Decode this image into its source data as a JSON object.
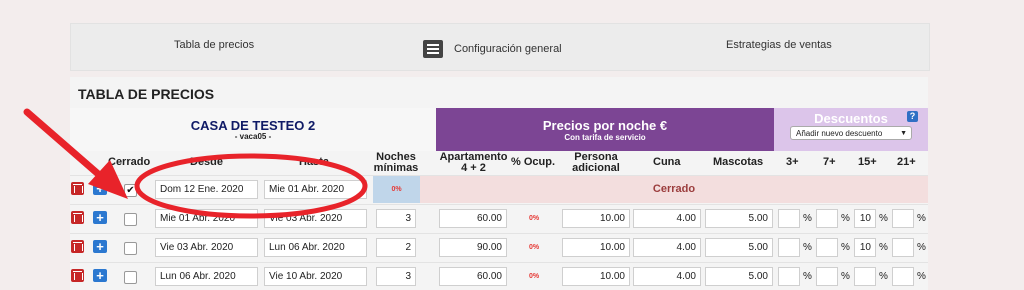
{
  "tabs": {
    "precios": "Tabla de precios",
    "config": "Configuración general",
    "estrategias": "Estrategias de ventas"
  },
  "page_title": "TABLA DE PRECIOS",
  "house": {
    "name": "CASA DE TESTEO 2",
    "code": "- vaca05 -"
  },
  "prices_header": {
    "title": "Precios por noche €",
    "subtitle": "Con tarifa de servicio"
  },
  "discounts": {
    "title": "Descuentos",
    "help": "?",
    "select_value": "Añadir nuevo descuento"
  },
  "columns": {
    "cerrado": "Cerrado",
    "desde": "Desde",
    "hasta": "Hasta",
    "noches_1": "Noches",
    "noches_2": "mínimas",
    "apto_1": "Apartamento",
    "apto_2": "4 + 2",
    "ocup": "% Ocup.",
    "persona_1": "Persona",
    "persona_2": "adicional",
    "cuna": "Cuna",
    "mascotas": "Mascotas",
    "d3": "3+",
    "d7": "7+",
    "d15": "15+",
    "d21": "21+"
  },
  "closed_row": {
    "desde": "Dom 12 Ene. 2020",
    "hasta": "Mie 01 Abr. 2020",
    "pct": "0%",
    "label": "Cerrado"
  },
  "rows": [
    {
      "desde": "Mie 01 Abr. 2020",
      "hasta": "Vie 03 Abr. 2020",
      "noches": "3",
      "apto": "60.00",
      "ocup": "0%",
      "persona": "10.00",
      "cuna": "4.00",
      "mascotas": "5.00",
      "d3": "",
      "d7": "",
      "d15": "10",
      "d21": ""
    },
    {
      "desde": "Vie 03 Abr. 2020",
      "hasta": "Lun 06 Abr. 2020",
      "noches": "2",
      "apto": "90.00",
      "ocup": "0%",
      "persona": "10.00",
      "cuna": "4.00",
      "mascotas": "5.00",
      "d3": "",
      "d7": "",
      "d15": "10",
      "d21": ""
    },
    {
      "desde": "Lun 06 Abr. 2020",
      "hasta": "Vie 10 Abr. 2020",
      "noches": "3",
      "apto": "60.00",
      "ocup": "0%",
      "persona": "10.00",
      "cuna": "4.00",
      "mascotas": "5.00",
      "d3": "",
      "d7": "",
      "d15": "",
      "d21": ""
    }
  ],
  "percent_sign": "%",
  "checkmark": "✔",
  "colors": {
    "prices_bg": "#7c4594",
    "discounts_bg": "#dcc5ea",
    "annotation": "#e8232a",
    "closed_bg": "#f3dede"
  }
}
